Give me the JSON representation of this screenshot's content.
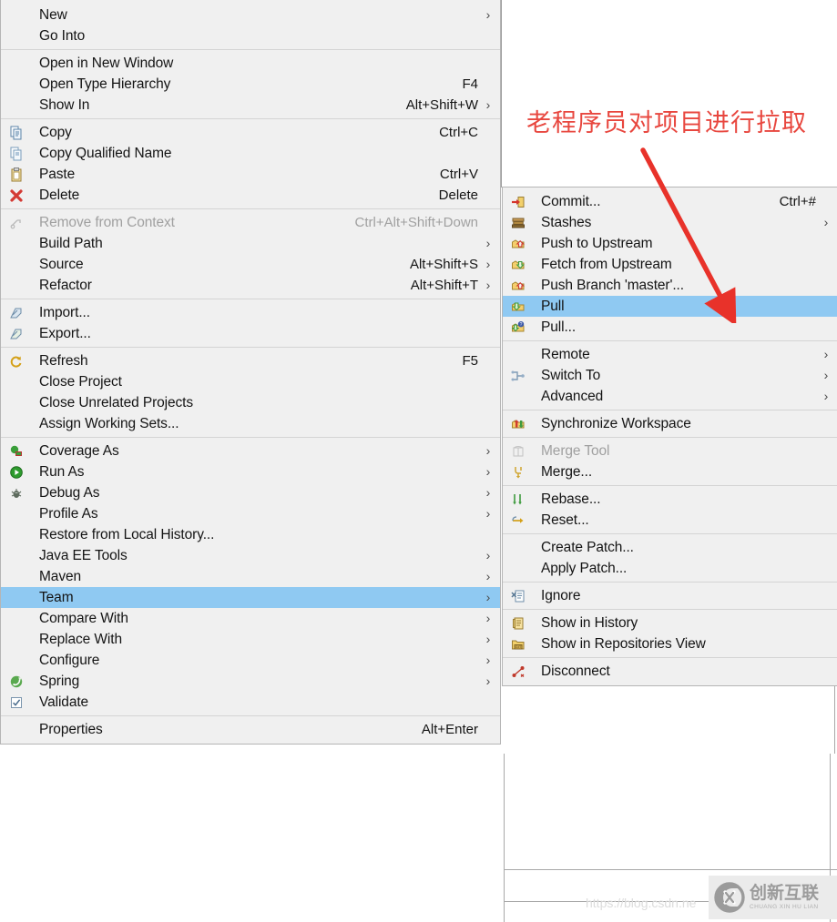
{
  "annotation": {
    "text": "老程序员对项目进行拉取",
    "color": "#e8473f",
    "arrow_color": "#e8322a"
  },
  "context_menu": {
    "name": "project-context-menu",
    "items": [
      {
        "label": "New",
        "accel": "",
        "arrow": true,
        "icon": "",
        "sep_after": false
      },
      {
        "label": "Go Into",
        "accel": "",
        "arrow": false,
        "icon": "",
        "sep_after": true
      },
      {
        "label": "Open in New Window",
        "accel": "",
        "arrow": false,
        "icon": "",
        "sep_after": false
      },
      {
        "label": "Open Type Hierarchy",
        "accel": "F4",
        "arrow": false,
        "icon": "",
        "sep_after": false
      },
      {
        "label": "Show In",
        "accel": "Alt+Shift+W",
        "arrow": true,
        "icon": "",
        "sep_after": true
      },
      {
        "label": "Copy",
        "accel": "Ctrl+C",
        "arrow": false,
        "icon": "copy-icon",
        "sep_after": false
      },
      {
        "label": "Copy Qualified Name",
        "accel": "",
        "arrow": false,
        "icon": "copy-qualified-icon",
        "sep_after": false
      },
      {
        "label": "Paste",
        "accel": "Ctrl+V",
        "arrow": false,
        "icon": "paste-icon",
        "sep_after": false
      },
      {
        "label": "Delete",
        "accel": "Delete",
        "arrow": false,
        "icon": "delete-icon",
        "sep_after": true
      },
      {
        "label": "Remove from Context",
        "accel": "Ctrl+Alt+Shift+Down",
        "arrow": false,
        "icon": "remove-context-icon",
        "disabled": true,
        "sep_after": false
      },
      {
        "label": "Build Path",
        "accel": "",
        "arrow": true,
        "icon": "",
        "sep_after": false
      },
      {
        "label": "Source",
        "accel": "Alt+Shift+S",
        "arrow": true,
        "icon": "",
        "sep_after": false
      },
      {
        "label": "Refactor",
        "accel": "Alt+Shift+T",
        "arrow": true,
        "icon": "",
        "sep_after": true
      },
      {
        "label": "Import...",
        "accel": "",
        "arrow": false,
        "icon": "import-icon",
        "sep_after": false
      },
      {
        "label": "Export...",
        "accel": "",
        "arrow": false,
        "icon": "export-icon",
        "sep_after": true
      },
      {
        "label": "Refresh",
        "accel": "F5",
        "arrow": false,
        "icon": "refresh-icon",
        "sep_after": false
      },
      {
        "label": "Close Project",
        "accel": "",
        "arrow": false,
        "icon": "",
        "sep_after": false
      },
      {
        "label": "Close Unrelated Projects",
        "accel": "",
        "arrow": false,
        "icon": "",
        "sep_after": false
      },
      {
        "label": "Assign Working Sets...",
        "accel": "",
        "arrow": false,
        "icon": "",
        "sep_after": true
      },
      {
        "label": "Coverage As",
        "accel": "",
        "arrow": true,
        "icon": "coverage-icon",
        "sep_after": false
      },
      {
        "label": "Run As",
        "accel": "",
        "arrow": true,
        "icon": "run-icon",
        "sep_after": false
      },
      {
        "label": "Debug As",
        "accel": "",
        "arrow": true,
        "icon": "debug-icon",
        "sep_after": false
      },
      {
        "label": "Profile As",
        "accel": "",
        "arrow": true,
        "icon": "",
        "sep_after": false
      },
      {
        "label": "Restore from Local History...",
        "accel": "",
        "arrow": false,
        "icon": "",
        "sep_after": false
      },
      {
        "label": "Java EE Tools",
        "accel": "",
        "arrow": true,
        "icon": "",
        "sep_after": false
      },
      {
        "label": "Maven",
        "accel": "",
        "arrow": true,
        "icon": "",
        "sep_after": false
      },
      {
        "label": "Team",
        "accel": "",
        "arrow": true,
        "icon": "",
        "selected": true,
        "sep_after": false
      },
      {
        "label": "Compare With",
        "accel": "",
        "arrow": true,
        "icon": "",
        "sep_after": false
      },
      {
        "label": "Replace With",
        "accel": "",
        "arrow": true,
        "icon": "",
        "sep_after": false
      },
      {
        "label": "Configure",
        "accel": "",
        "arrow": true,
        "icon": "",
        "sep_after": false
      },
      {
        "label": "Spring",
        "accel": "",
        "arrow": true,
        "icon": "spring-icon",
        "sep_after": false
      },
      {
        "label": "Validate",
        "accel": "",
        "arrow": false,
        "icon": "checkbox-icon",
        "sep_after": true
      },
      {
        "label": "Properties",
        "accel": "Alt+Enter",
        "arrow": false,
        "icon": "",
        "sep_after": false
      }
    ]
  },
  "team_submenu": {
    "name": "team-submenu",
    "items": [
      {
        "label": "Commit...",
        "accel": "Ctrl+#",
        "arrow": false,
        "icon": "commit-icon",
        "sep_after": false
      },
      {
        "label": "Stashes",
        "accel": "",
        "arrow": true,
        "icon": "stashes-icon",
        "sep_after": false
      },
      {
        "label": "Push to Upstream",
        "accel": "",
        "arrow": false,
        "icon": "push-icon",
        "sep_after": false
      },
      {
        "label": "Fetch from Upstream",
        "accel": "",
        "arrow": false,
        "icon": "fetch-icon",
        "sep_after": false
      },
      {
        "label": "Push Branch 'master'...",
        "accel": "",
        "arrow": false,
        "icon": "push-icon",
        "sep_after": false
      },
      {
        "label": "Pull",
        "accel": "",
        "arrow": false,
        "icon": "pull-icon",
        "selected": true,
        "sep_after": false
      },
      {
        "label": "Pull...",
        "accel": "",
        "arrow": false,
        "icon": "pull-dialog-icon",
        "sep_after": true
      },
      {
        "label": "Remote",
        "accel": "",
        "arrow": true,
        "icon": "",
        "sep_after": false
      },
      {
        "label": "Switch To",
        "accel": "",
        "arrow": true,
        "icon": "switch-to-icon",
        "sep_after": false
      },
      {
        "label": "Advanced",
        "accel": "",
        "arrow": true,
        "icon": "",
        "sep_after": true
      },
      {
        "label": "Synchronize Workspace",
        "accel": "",
        "arrow": false,
        "icon": "synchronize-icon",
        "sep_after": true
      },
      {
        "label": "Merge Tool",
        "accel": "",
        "arrow": false,
        "icon": "merge-tool-icon",
        "disabled": true,
        "sep_after": false
      },
      {
        "label": "Merge...",
        "accel": "",
        "arrow": false,
        "icon": "merge-icon",
        "sep_after": true
      },
      {
        "label": "Rebase...",
        "accel": "",
        "arrow": false,
        "icon": "rebase-icon",
        "sep_after": false
      },
      {
        "label": "Reset...",
        "accel": "",
        "arrow": false,
        "icon": "reset-icon",
        "sep_after": true
      },
      {
        "label": "Create Patch...",
        "accel": "",
        "arrow": false,
        "icon": "",
        "sep_after": false
      },
      {
        "label": "Apply Patch...",
        "accel": "",
        "arrow": false,
        "icon": "",
        "sep_after": true
      },
      {
        "label": "Ignore",
        "accel": "",
        "arrow": false,
        "icon": "ignore-icon",
        "sep_after": true
      },
      {
        "label": "Show in History",
        "accel": "",
        "arrow": false,
        "icon": "history-icon",
        "sep_after": false
      },
      {
        "label": "Show in Repositories View",
        "accel": "",
        "arrow": false,
        "icon": "repositories-icon",
        "sep_after": true
      },
      {
        "label": "Disconnect",
        "accel": "",
        "arrow": false,
        "icon": "disconnect-icon",
        "sep_after": false
      }
    ]
  },
  "watermark": {
    "url": "https://blog.csdn.ne",
    "brand_cn": "创新互联",
    "brand_pinyin": "CHUANG XIN HU LIAN"
  }
}
